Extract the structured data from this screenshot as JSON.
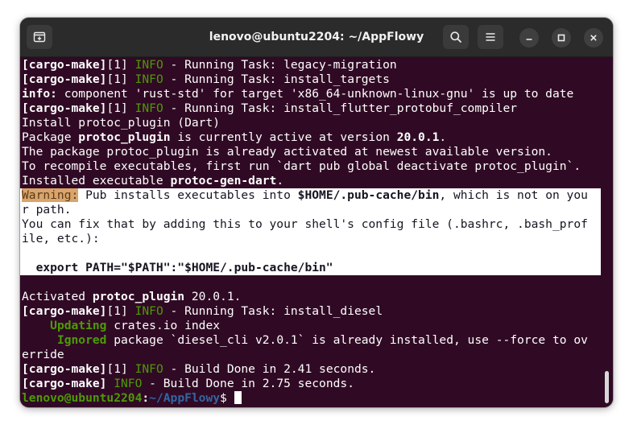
{
  "window": {
    "title": "lenovo@ubuntu2204: ~/AppFlowy",
    "new_tab_icon": "new-tab-icon",
    "search_icon": "search-icon",
    "menu_icon": "hamburger-menu-icon",
    "minimize_icon": "minimize-icon",
    "maximize_icon": "maximize-icon",
    "close_icon": "close-icon"
  },
  "colors": {
    "terminal_bg": "#300a24",
    "info_green": "#4e9a06",
    "path_blue": "#3465a4",
    "warning_bg": "#d9a56a"
  },
  "terminal": {
    "l1": {
      "tag": "[cargo-make]",
      "rest_a": "[1] ",
      "info": "INFO",
      "rest_b": " - Running Task: legacy-migration"
    },
    "l2": {
      "tag": "[cargo-make]",
      "rest_a": "[1] ",
      "info": "INFO",
      "rest_b": " - Running Task: install_targets"
    },
    "l3": {
      "label": "info:",
      "text": " component 'rust-std' for target 'x86_64-unknown-linux-gnu' is up to date"
    },
    "l4": {
      "tag": "[cargo-make]",
      "rest_a": "[1] ",
      "info": "INFO",
      "rest_b": " - Running Task: install_flutter_protobuf_compiler"
    },
    "l5": {
      "text": "Install protoc_plugin (Dart)"
    },
    "l6": {
      "a": "Package ",
      "b": "protoc_plugin",
      "c": " is currently active at version ",
      "d": "20.0.1",
      "e": "."
    },
    "l7": {
      "text": "The package protoc_plugin is already activated at newest available version."
    },
    "l8": {
      "text": "To recompile executables, first run `dart pub global deactivate protoc_plugin`."
    },
    "l9": {
      "a": "Installed executable ",
      "b": "protoc-gen-dart",
      "c": "."
    },
    "w1": {
      "warn": "Warning:",
      "a": " Pub installs executables into ",
      "b": "$HOME/.pub-cache/bin",
      "c": ", which is not on you"
    },
    "w2": {
      "text": "r path."
    },
    "w3": {
      "text": "You can fix that by adding this to your shell's config file (.bashrc, .bash_prof"
    },
    "w4": {
      "text": "ile, etc.):"
    },
    "w5": {
      "text": ""
    },
    "w6": {
      "text": "  export PATH=\"$PATH\":\"$HOME/.pub-cache/bin\""
    },
    "l10": {
      "a": "Activated ",
      "b": "protoc_plugin",
      "c": " 20.0.1."
    },
    "l11": {
      "tag": "[cargo-make]",
      "rest_a": "[1] ",
      "info": "INFO",
      "rest_b": " - Running Task: install_diesel"
    },
    "l12": {
      "indent": "    ",
      "status": "Updating",
      "text": " crates.io index"
    },
    "l13": {
      "indent": "     ",
      "status": "Ignored",
      "text": " package `diesel_cli v2.0.1` is already installed, use --force to ov"
    },
    "l14": {
      "text": "erride"
    },
    "l15": {
      "tag": "[cargo-make]",
      "rest_a": "[1] ",
      "info": "INFO",
      "rest_b": " - Build Done in 2.41 seconds."
    },
    "l16": {
      "tag": "[cargo-make]",
      "rest_a": " ",
      "info": "INFO",
      "rest_b": " - Build Done in 2.75 seconds."
    },
    "prompt": {
      "user_host": "lenovo@ubuntu2204",
      "sep": ":",
      "path": "~/AppFlowy",
      "symbol": "$ "
    }
  }
}
